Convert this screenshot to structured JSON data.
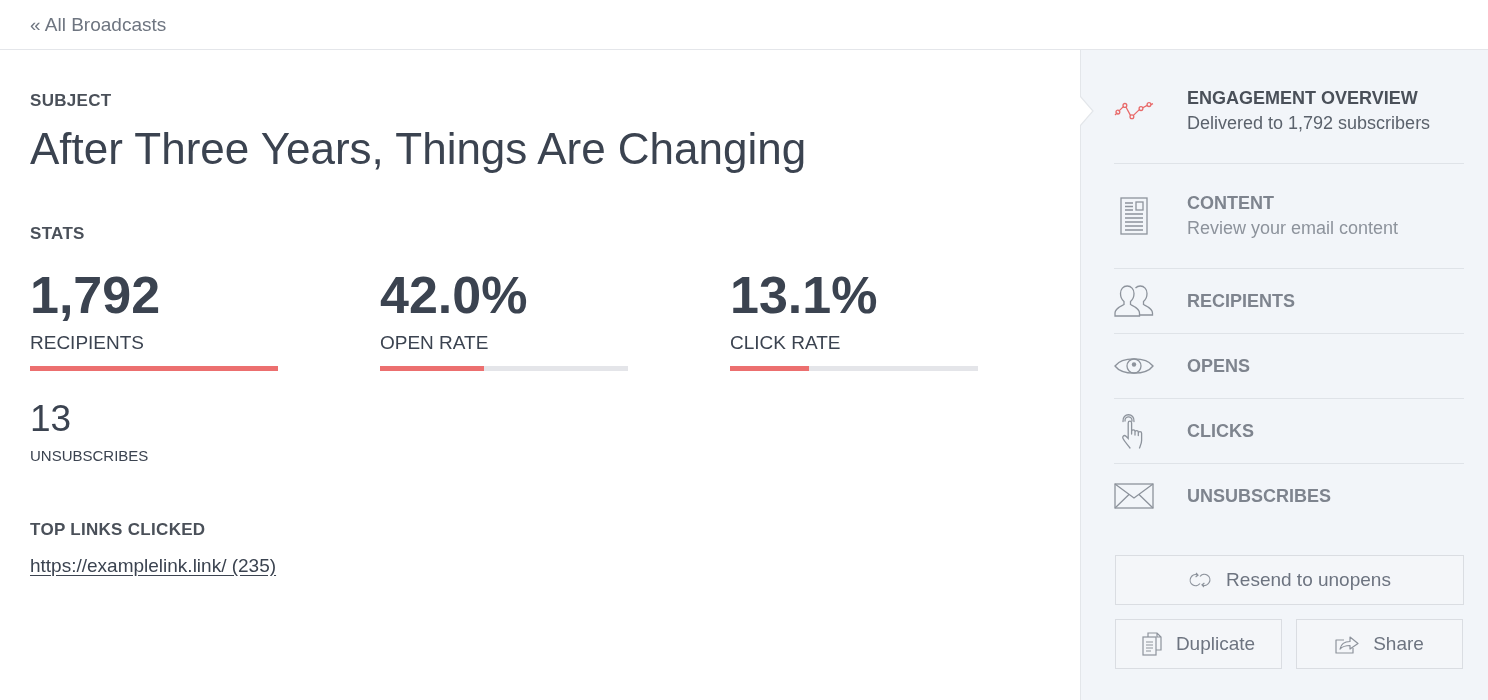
{
  "back_link": {
    "label": "« All Broadcasts"
  },
  "subject": {
    "heading": "SUBJECT",
    "title": "After Three Years, Things Are Changing"
  },
  "stats": {
    "heading": "STATS",
    "metrics": [
      {
        "value": "1,792",
        "label": "RECIPIENTS",
        "level": 1
      },
      {
        "value": "42.0%",
        "label": "OPEN RATE",
        "level": 0.42
      },
      {
        "value": "13.1%",
        "label": "CLICK RATE",
        "level": 0.32
      }
    ],
    "unsubscribes": {
      "value": "13",
      "label": "UNSUBSCRIBES"
    }
  },
  "top_links": {
    "heading": "TOP LINKS CLICKED",
    "links": [
      "https://examplelink.link/ (235)"
    ]
  },
  "sidebar": {
    "items": [
      {
        "kind": "chart",
        "title": "ENGAGEMENT OVERVIEW",
        "subtitle": "Delivered to 1,792 subscribers",
        "selected": true
      },
      {
        "kind": "document",
        "title": "CONTENT",
        "subtitle": "Review your email content",
        "selected": false
      },
      {
        "kind": "people",
        "title": "RECIPIENTS",
        "selected": false
      },
      {
        "kind": "eye",
        "title": "OPENS",
        "selected": false
      },
      {
        "kind": "pointer",
        "title": "CLICKS",
        "selected": false
      },
      {
        "kind": "envelope",
        "title": "UNSUBSCRIBES",
        "selected": false
      }
    ],
    "buttons": [
      {
        "kind": "resend",
        "label": "Resend to unopens"
      },
      {
        "kind": "duplicate",
        "label": "Duplicate"
      },
      {
        "kind": "share",
        "label": "Share"
      }
    ]
  }
}
